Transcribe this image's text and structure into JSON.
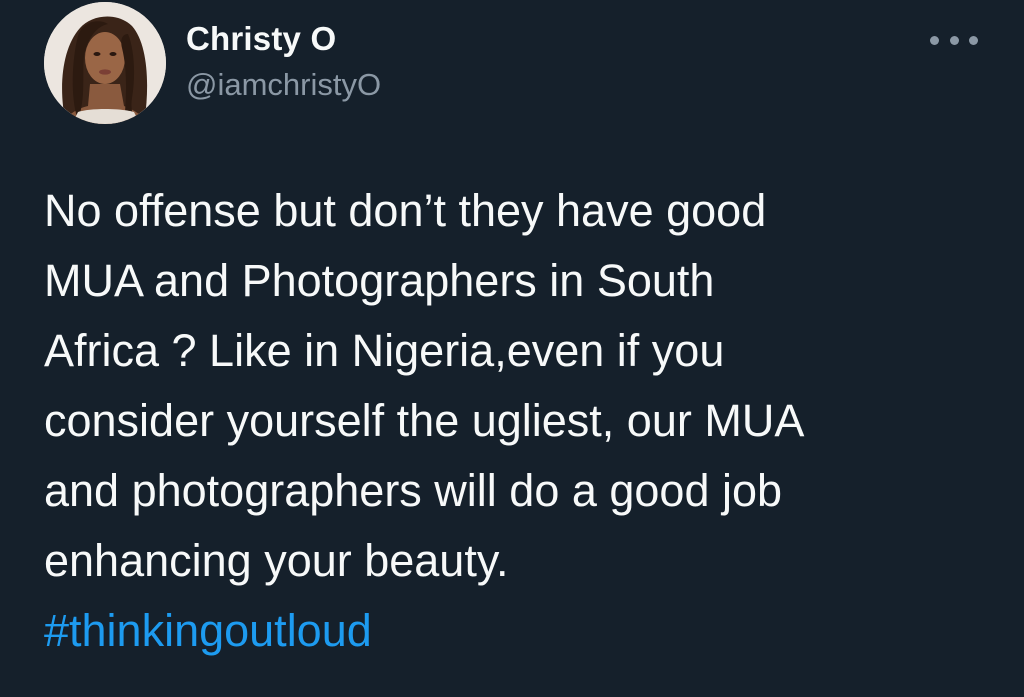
{
  "author": {
    "display_name": "Christy O",
    "handle": "@iamchristyO"
  },
  "tweet": {
    "lines": [
      "No offense but don’t they have good",
      "MUA and Photographers in South",
      "Africa ? Like in Nigeria,even if you",
      "consider yourself the ugliest, our MUA",
      "and photographers will do a good job",
      "enhancing your beauty."
    ],
    "hashtag": "#thinkingoutloud"
  },
  "theme": {
    "background": "#15202b",
    "text": "#f7f9f9",
    "secondary_text": "#8b98a5",
    "link": "#1d9bf0"
  },
  "icons": {
    "more": "more-options-icon"
  }
}
